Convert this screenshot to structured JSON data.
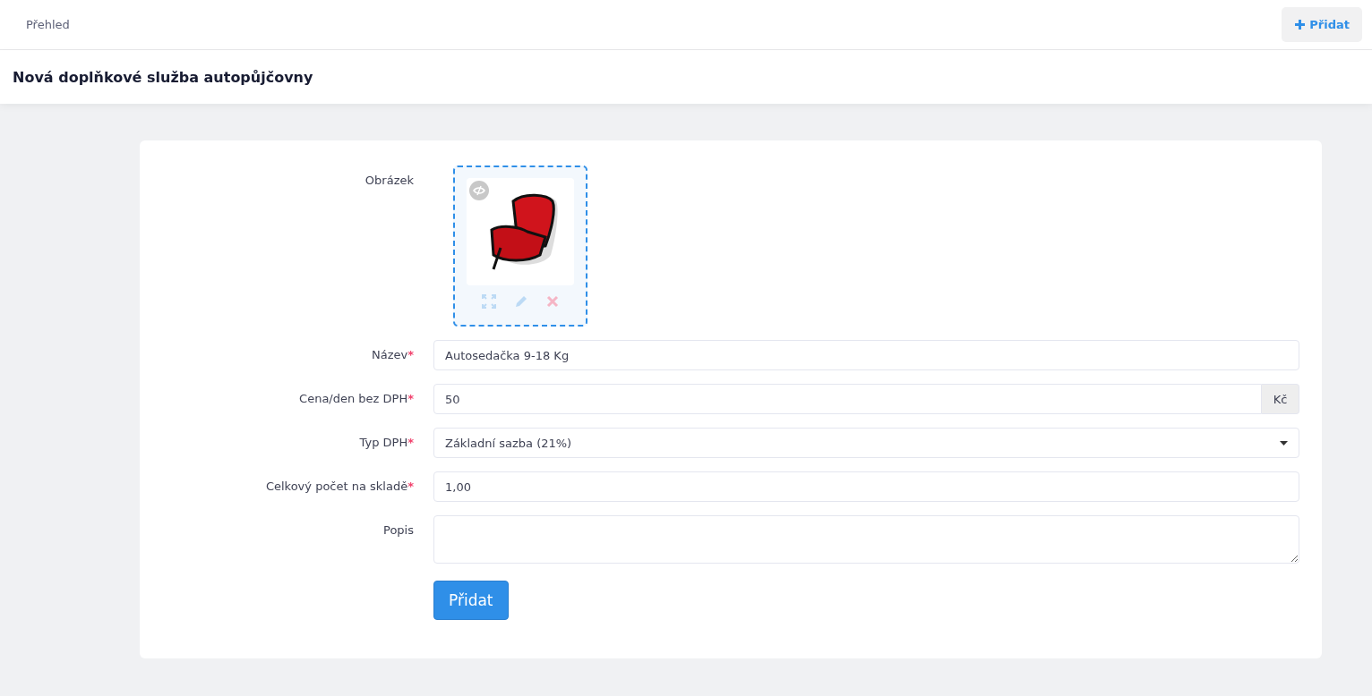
{
  "topbar": {
    "breadcrumb": "Přehled",
    "add_button": "Přidat"
  },
  "page_title": "Nová doplňkové služba autopůjčovny",
  "form": {
    "image_label": "Obrázek",
    "fields": [
      {
        "kind": "text",
        "label": "Název",
        "required_mark": "*",
        "value": "Autosedačka 9-18 Kg"
      },
      {
        "kind": "addon",
        "label": "Cena/den bez DPH",
        "required_mark": "*",
        "value": "50",
        "addon": "Kč"
      },
      {
        "kind": "select",
        "label": "Typ DPH",
        "required_mark": "*",
        "value": "Základní sazba (21%)"
      },
      {
        "kind": "text",
        "label": "Celkový počet na skladě",
        "required_mark": "*",
        "value": "1,00"
      },
      {
        "kind": "textarea",
        "label": "Popis"
      }
    ],
    "submit": "Přidat"
  }
}
